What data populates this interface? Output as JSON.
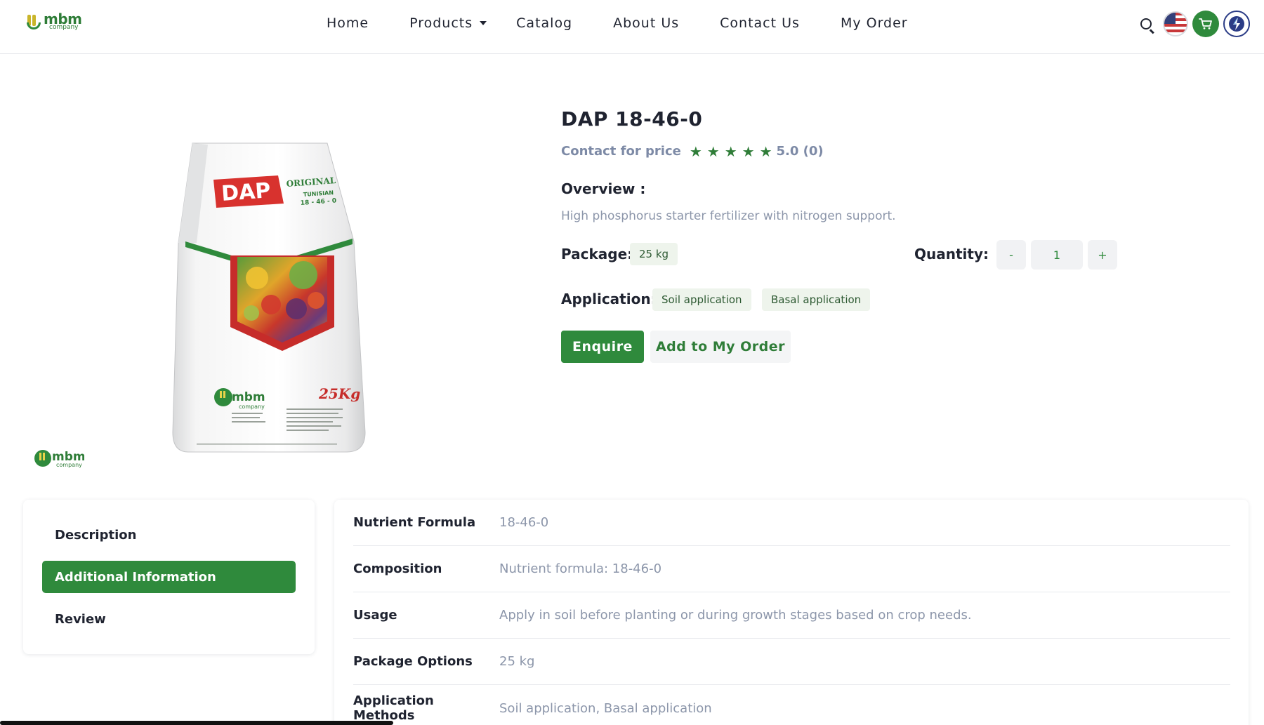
{
  "brand": {
    "logo_word": "mbm",
    "logo_sub": "company"
  },
  "nav": {
    "home": "Home",
    "products": "Products",
    "catalog": "Catalog",
    "about": "About Us",
    "contact": "Contact Us",
    "my_order": "My Order"
  },
  "header_icons": [
    "search-icon",
    "us-flag-icon",
    "cart-icon",
    "language-switch-icon"
  ],
  "product": {
    "title": "DAP 18-46-0",
    "price_text": "Contact for price",
    "rating_text": "5.0 (0)",
    "rating_value": 5,
    "overview_label": "Overview :",
    "overview_text": "High phosphorus starter fertilizer with nitrogen support.",
    "package_label": "Package:",
    "package_options": [
      "25 kg"
    ],
    "quantity_label": "Quantity:",
    "quantity_value": "1",
    "quantity_minus": "-",
    "quantity_plus": "+",
    "application_label": "Application:",
    "application_options": [
      "Soil application",
      "Basal application"
    ],
    "enquire_label": "Enquire",
    "add_order_label": "Add to My Order"
  },
  "bag": {
    "brand_tag": "DAP",
    "origin_line1": "ORIGINAL",
    "origin_line2": "TUNISIAN",
    "origin_line3": "18 - 46 - 0",
    "weight": "25Kg",
    "logo_word": "mbm",
    "logo_sub": "company"
  },
  "tabs": [
    {
      "label": "Description",
      "active": false
    },
    {
      "label": "Additional Information",
      "active": true
    },
    {
      "label": "Review",
      "active": false
    }
  ],
  "info_table": [
    {
      "key": "Nutrient Formula",
      "value": "18-46-0"
    },
    {
      "key": "Composition",
      "value": "Nutrient formula: 18-46-0"
    },
    {
      "key": "Usage",
      "value": "Apply in soil before planting or during growth stages based on crop needs."
    },
    {
      "key": "Package Options",
      "value": "25 kg"
    },
    {
      "key": "Application Methods",
      "value": "Soil application, Basal application"
    }
  ],
  "colors": {
    "accent": "#2f8a3c",
    "muted_text": "#8c96aa",
    "pill_bg": "#eef4ec"
  }
}
